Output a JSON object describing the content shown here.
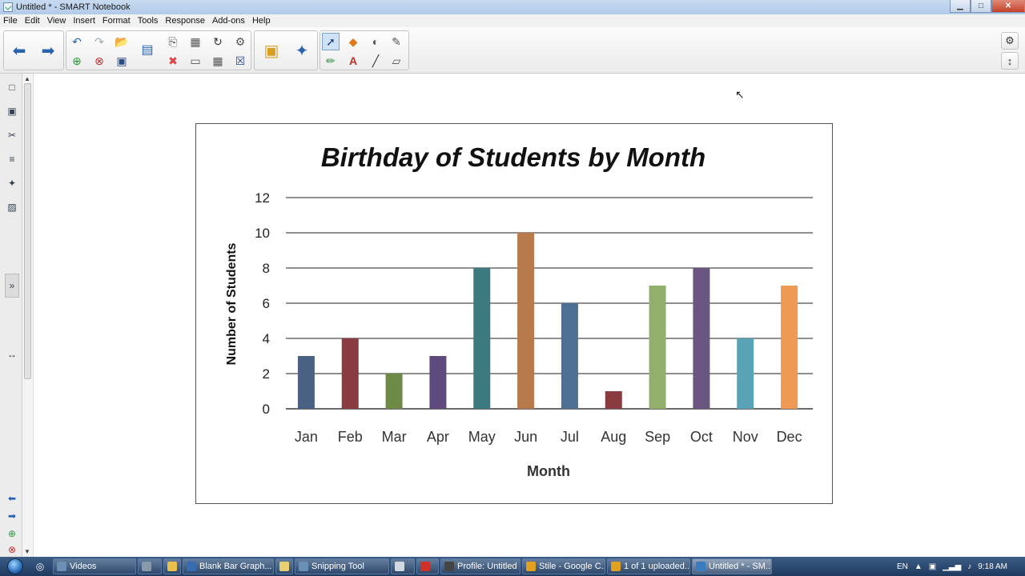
{
  "window": {
    "title": "Untitled * - SMART Notebook"
  },
  "menu": [
    "File",
    "Edit",
    "View",
    "Insert",
    "Format",
    "Tools",
    "Response",
    "Add-ons",
    "Help"
  ],
  "toolbar": {
    "icons": [
      "back-icon",
      "forward-icon",
      "undo-icon",
      "redo-icon",
      "open-icon",
      "add-page-icon",
      "delete-page-icon",
      "save-icon",
      "display-icon",
      "paste-icon",
      "screenshade-icon",
      "insert-image-icon",
      "fullscreen-icon",
      "capture-icon",
      "delete-icon",
      "table-icon",
      "clear-icon",
      "gallery-icon",
      "addons-icon",
      "select-icon",
      "shapes-icon",
      "fill-icon",
      "magic-pen-icon",
      "pens-icon",
      "text-icon",
      "line-icon",
      "eraser-icon"
    ]
  },
  "chart_data": {
    "type": "bar",
    "title": "Birthday of Students by Month",
    "xlabel": "Month",
    "ylabel": "Number of Students",
    "ylim": [
      0,
      12
    ],
    "yticks": [
      "0",
      "2",
      "4",
      "6",
      "8",
      "10",
      "12"
    ],
    "grid": true,
    "categories": [
      "Jan",
      "Feb",
      "Mar",
      "Apr",
      "May",
      "Jun",
      "Jul",
      "Aug",
      "Sep",
      "Oct",
      "Nov",
      "Dec"
    ],
    "values": [
      3,
      4,
      2,
      3,
      8,
      10,
      6,
      1,
      7,
      8,
      4,
      7
    ],
    "colors": [
      "#4a6184",
      "#8a3b3f",
      "#6f8a46",
      "#5e4a7c",
      "#3c7a80",
      "#b87a4b",
      "#4e6f94",
      "#8a3b3f",
      "#92b06c",
      "#6b5682",
      "#5aa3b6",
      "#ee9a55"
    ]
  },
  "taskbar": {
    "tasks": [
      {
        "label": "Videos",
        "color": "#6b8fb5"
      },
      {
        "label": "",
        "color": "#8899aa"
      },
      {
        "label": "",
        "color": "#e8c050"
      },
      {
        "label": "Blank Bar Graph...",
        "color": "#3a6cb0"
      },
      {
        "label": "",
        "color": "#e8d070"
      },
      {
        "label": "Snipping Tool",
        "color": "#6a8fb8"
      },
      {
        "label": "",
        "color": "#d0d8e0"
      },
      {
        "label": "",
        "color": "#d0302a"
      },
      {
        "label": "Profile: Untitled ...",
        "color": "#444444"
      },
      {
        "label": "Stile - Google C...",
        "color": "#e0a020"
      },
      {
        "label": "1 of 1 uploaded...",
        "color": "#e0a020"
      },
      {
        "label": "Untitled * - SM...",
        "color": "#3a7cc0"
      }
    ],
    "lang": "EN",
    "time": "9:18 AM"
  }
}
